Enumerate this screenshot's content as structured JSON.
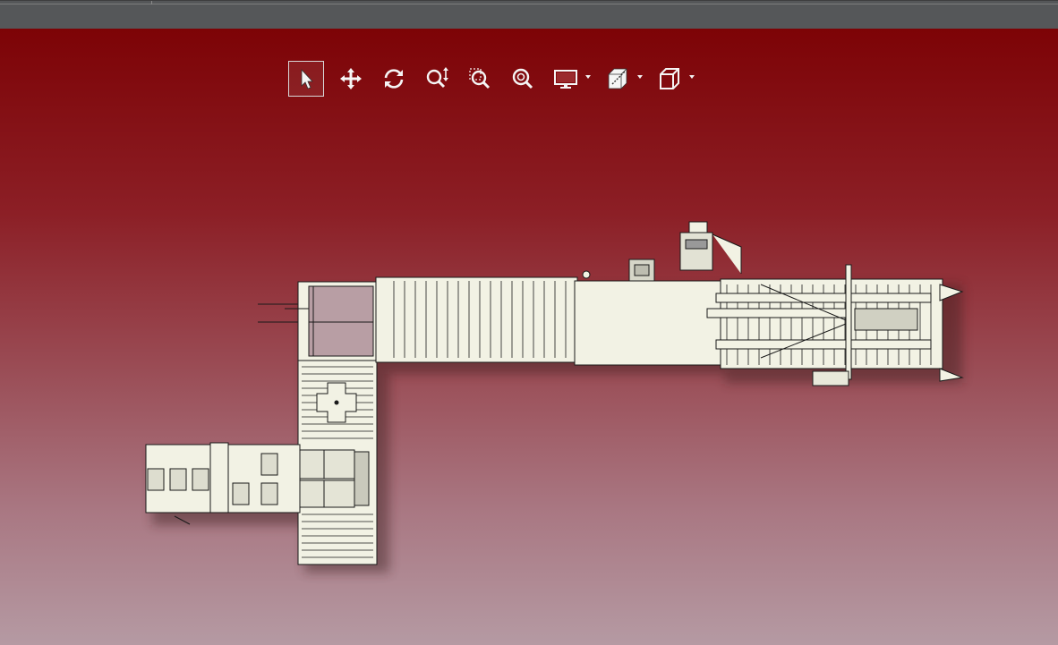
{
  "app": {
    "name": "",
    "background": {
      "top": "#7d0306",
      "bottom": "#b59aa3"
    }
  },
  "toolbar": {
    "tools": [
      {
        "id": "select",
        "icon": "arrow-pointer-icon",
        "active": true,
        "dropdown": false
      },
      {
        "id": "pan",
        "icon": "move-arrows-icon",
        "active": false,
        "dropdown": false
      },
      {
        "id": "rotate",
        "icon": "rotate-icon",
        "active": false,
        "dropdown": false
      },
      {
        "id": "zoom",
        "icon": "zoom-updown-icon",
        "active": false,
        "dropdown": false
      },
      {
        "id": "zoom-window",
        "icon": "zoom-window-icon",
        "active": false,
        "dropdown": false
      },
      {
        "id": "zoom-fit",
        "icon": "zoom-fit-icon",
        "active": false,
        "dropdown": false
      },
      {
        "id": "display-mode",
        "icon": "monitor-icon",
        "active": false,
        "dropdown": true
      },
      {
        "id": "section",
        "icon": "section-cube-icon",
        "active": false,
        "dropdown": true
      },
      {
        "id": "view-orientation",
        "icon": "cube-icon",
        "active": false,
        "dropdown": true
      }
    ]
  },
  "model": {
    "name": "",
    "colors": {
      "fill": "#f2f2e4",
      "stroke": "#1a1a1a",
      "shadow": "#3a1a1e"
    }
  }
}
